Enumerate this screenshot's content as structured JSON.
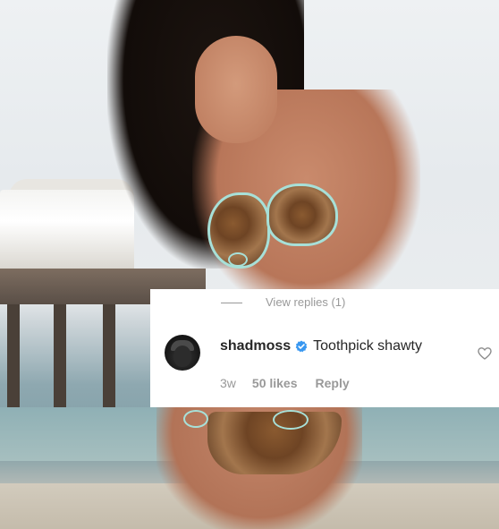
{
  "photo": {
    "subject": "woman-in-leopard-bikini-on-beach"
  },
  "comment": {
    "view_replies": "View replies (1)",
    "username": "shadmoss",
    "verified_icon": "verified-badge-icon",
    "text": "Toothpick shawty",
    "time": "3w",
    "likes": "50 likes",
    "reply_label": "Reply",
    "like_icon": "heart-icon"
  },
  "colors": {
    "verified": "#3897f0",
    "text_primary": "#262626",
    "text_muted": "#999999",
    "card_bg": "#ffffff"
  }
}
